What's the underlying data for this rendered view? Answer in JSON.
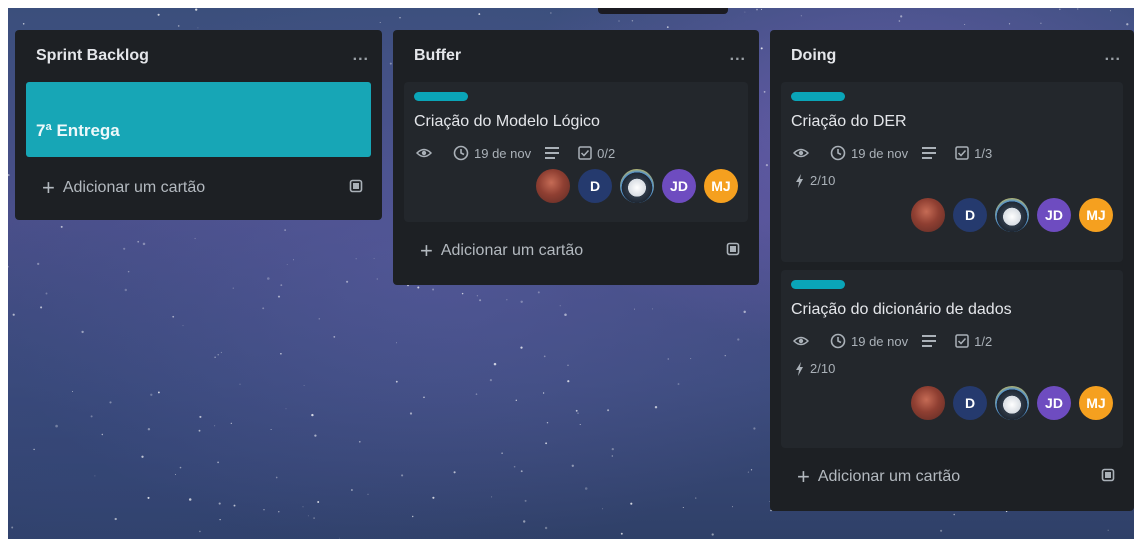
{
  "colors": {
    "label": "#0aa5b8",
    "cover": "#17a6b6",
    "list_bg": "#1d2024",
    "card_bg": "#23272c"
  },
  "lists": [
    {
      "title": "Sprint Backlog",
      "menu": "...",
      "cards": [
        {
          "title": "7ª Entrega"
        }
      ],
      "add_card": "Adicionar um cartão",
      "template_icon": "card-template-icon"
    },
    {
      "title": "Buffer",
      "menu": "...",
      "cards": [
        {
          "title": "Criação do Modelo Lógico",
          "due": "19 de nov",
          "checklist": "0/2",
          "members": [
            {
              "initials": "",
              "kind": "photo"
            },
            {
              "initials": "D",
              "kind": "d"
            },
            {
              "initials": "",
              "kind": "tux"
            },
            {
              "initials": "JD",
              "kind": "jd"
            },
            {
              "initials": "MJ",
              "kind": "mj"
            }
          ]
        }
      ],
      "add_card": "Adicionar um cartão",
      "template_icon": "card-template-icon"
    },
    {
      "title": "Doing",
      "menu": "...",
      "cards": [
        {
          "title": "Criação do DER",
          "due": "19 de nov",
          "checklist": "1/3",
          "points": "2/10",
          "members": [
            {
              "initials": "",
              "kind": "photo"
            },
            {
              "initials": "D",
              "kind": "d"
            },
            {
              "initials": "",
              "kind": "tux"
            },
            {
              "initials": "JD",
              "kind": "jd"
            },
            {
              "initials": "MJ",
              "kind": "mj"
            }
          ]
        },
        {
          "title": "Criação do dicionário de dados",
          "due": "19 de nov",
          "checklist": "1/2",
          "points": "2/10",
          "members": [
            {
              "initials": "",
              "kind": "photo"
            },
            {
              "initials": "D",
              "kind": "d"
            },
            {
              "initials": "",
              "kind": "tux"
            },
            {
              "initials": "JD",
              "kind": "jd"
            },
            {
              "initials": "MJ",
              "kind": "mj"
            }
          ]
        }
      ],
      "add_card": "Adicionar um cartão",
      "template_icon": "card-template-icon"
    }
  ]
}
